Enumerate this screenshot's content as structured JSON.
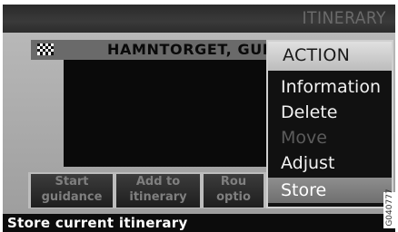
{
  "header": {
    "title": "ITINERARY"
  },
  "destination": {
    "name": "HAMNTORGET, GULI",
    "icon": "checkered-flag-icon"
  },
  "softkeys": [
    {
      "label": "Start\nguidance"
    },
    {
      "label": "Add to\nitinerary"
    },
    {
      "label": "Rou\noptio"
    }
  ],
  "action_menu": {
    "title": "ACTION",
    "items": [
      {
        "label": "Information",
        "state": "enabled"
      },
      {
        "label": "Delete",
        "state": "enabled"
      },
      {
        "label": "Move",
        "state": "disabled"
      },
      {
        "label": "Adjust",
        "state": "enabled"
      },
      {
        "label": "Store",
        "state": "selected"
      }
    ]
  },
  "status": {
    "text": "Store current itinerary"
  },
  "watermark": {
    "text": "G040777"
  }
}
